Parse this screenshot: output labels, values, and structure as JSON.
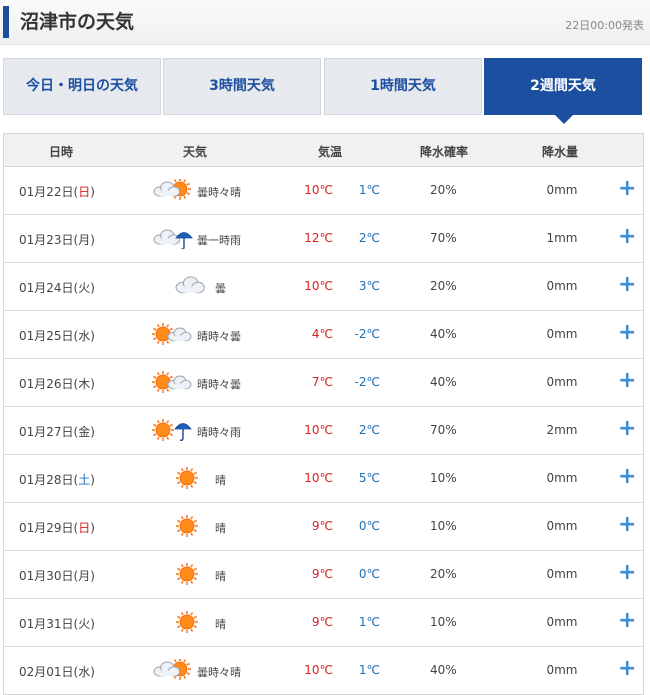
{
  "header": {
    "title": "沼津市の天気",
    "published": "22日00:00発表"
  },
  "tabs": [
    {
      "label": "今日・明日の天気",
      "active": false
    },
    {
      "label": "3時間天気",
      "active": false
    },
    {
      "label": "1時間天気",
      "active": false
    },
    {
      "label": "2週間天気",
      "active": true
    }
  ],
  "columns": {
    "date": "日時",
    "weather": "天気",
    "temp": "気温",
    "pop": "降水確率",
    "amount": "降水量"
  },
  "colors": {
    "accent": "#1d4fa0",
    "high": "#d42020",
    "low": "#1a6fb8",
    "sunday": "#d42020",
    "saturday": "#1a6fb8",
    "plus": "#3a8ed6"
  },
  "rows": [
    {
      "date_pre": "01月22日(",
      "day": "日",
      "date_post": ")",
      "day_type": "sun",
      "weather": "曇時々晴",
      "icon": "cloudy-then-sunny-icon",
      "high": "10℃",
      "low": "1℃",
      "pop": "20%",
      "amount": "0mm"
    },
    {
      "date_pre": "01月23日(",
      "day": "月",
      "date_post": ")",
      "day_type": "weekday",
      "weather": "曇一時雨",
      "icon": "cloudy-then-rain-icon",
      "high": "12℃",
      "low": "2℃",
      "pop": "70%",
      "amount": "1mm"
    },
    {
      "date_pre": "01月24日(",
      "day": "火",
      "date_post": ")",
      "day_type": "weekday",
      "weather": "曇",
      "icon": "cloudy-icon",
      "high": "10℃",
      "low": "3℃",
      "pop": "20%",
      "amount": "0mm"
    },
    {
      "date_pre": "01月25日(",
      "day": "水",
      "date_post": ")",
      "day_type": "weekday",
      "weather": "晴時々曇",
      "icon": "sunny-then-cloudy-icon",
      "high": "4℃",
      "low": "-2℃",
      "pop": "40%",
      "amount": "0mm"
    },
    {
      "date_pre": "01月26日(",
      "day": "木",
      "date_post": ")",
      "day_type": "weekday",
      "weather": "晴時々曇",
      "icon": "sunny-then-cloudy-icon",
      "high": "7℃",
      "low": "-2℃",
      "pop": "40%",
      "amount": "0mm"
    },
    {
      "date_pre": "01月27日(",
      "day": "金",
      "date_post": ")",
      "day_type": "weekday",
      "weather": "晴時々雨",
      "icon": "sunny-then-rain-icon",
      "high": "10℃",
      "low": "2℃",
      "pop": "70%",
      "amount": "2mm"
    },
    {
      "date_pre": "01月28日(",
      "day": "土",
      "date_post": ")",
      "day_type": "sat",
      "weather": "晴",
      "icon": "sunny-icon",
      "high": "10℃",
      "low": "5℃",
      "pop": "10%",
      "amount": "0mm"
    },
    {
      "date_pre": "01月29日(",
      "day": "日",
      "date_post": ")",
      "day_type": "sun",
      "weather": "晴",
      "icon": "sunny-icon",
      "high": "9℃",
      "low": "0℃",
      "pop": "10%",
      "amount": "0mm"
    },
    {
      "date_pre": "01月30日(",
      "day": "月",
      "date_post": ")",
      "day_type": "weekday",
      "weather": "晴",
      "icon": "sunny-icon",
      "high": "9℃",
      "low": "0℃",
      "pop": "20%",
      "amount": "0mm"
    },
    {
      "date_pre": "01月31日(",
      "day": "火",
      "date_post": ")",
      "day_type": "weekday",
      "weather": "晴",
      "icon": "sunny-icon",
      "high": "9℃",
      "low": "1℃",
      "pop": "10%",
      "amount": "0mm"
    },
    {
      "date_pre": "02月01日(",
      "day": "水",
      "date_post": ")",
      "day_type": "weekday",
      "weather": "曇時々晴",
      "icon": "cloudy-then-sunny-icon",
      "high": "10℃",
      "low": "1℃",
      "pop": "40%",
      "amount": "0mm"
    }
  ],
  "expand_symbol": "+"
}
